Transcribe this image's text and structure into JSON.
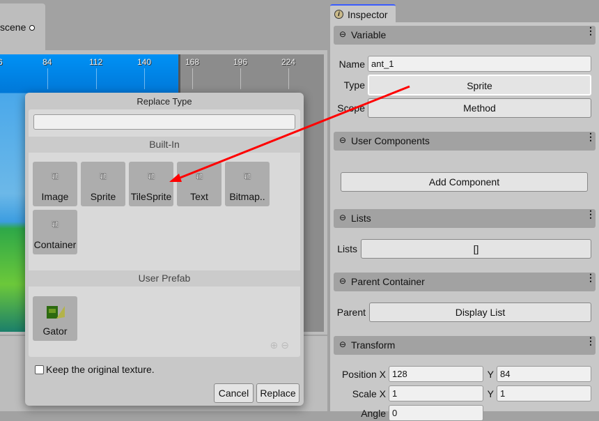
{
  "scene_tab": {
    "label": "scene"
  },
  "ruler": {
    "ticks": [
      "6",
      "84",
      "112",
      "140",
      "168",
      "196",
      "224"
    ]
  },
  "dialog": {
    "title": "Replace Type",
    "search_value": "",
    "builtin_header": "Built-In",
    "builtin_items": [
      {
        "label": "Image"
      },
      {
        "label": "Sprite"
      },
      {
        "label": "TileSprite"
      },
      {
        "label": "Text"
      },
      {
        "label": "Bitmap.."
      },
      {
        "label": "Container"
      }
    ],
    "prefab_header": "User Prefab",
    "prefab_items": [
      {
        "label": "Gator"
      }
    ],
    "keep_texture_label": "Keep the original texture.",
    "keep_texture_checked": false,
    "cancel_label": "Cancel",
    "replace_label": "Replace"
  },
  "inspector": {
    "tab_label": "Inspector",
    "variable": {
      "title": "Variable",
      "name_label": "Name",
      "name_value": "ant_1",
      "type_label": "Type",
      "type_value": "Sprite",
      "scope_label": "Scope",
      "scope_value": "Method"
    },
    "user_components": {
      "title": "User Components",
      "add_label": "Add Component"
    },
    "lists": {
      "title": "Lists",
      "label": "Lists",
      "value": "[]"
    },
    "parent_container": {
      "title": "Parent Container",
      "label": "Parent",
      "value": "Display List"
    },
    "transform": {
      "title": "Transform",
      "position_label": "Position X",
      "position_x": "128",
      "y_label": "Y",
      "position_y": "84",
      "scale_label": "Scale X",
      "scale_x": "1",
      "scale_y": "1",
      "angle_label": "Angle",
      "angle": "0"
    }
  },
  "annotation": {
    "arrow_color": "#ff0000"
  }
}
